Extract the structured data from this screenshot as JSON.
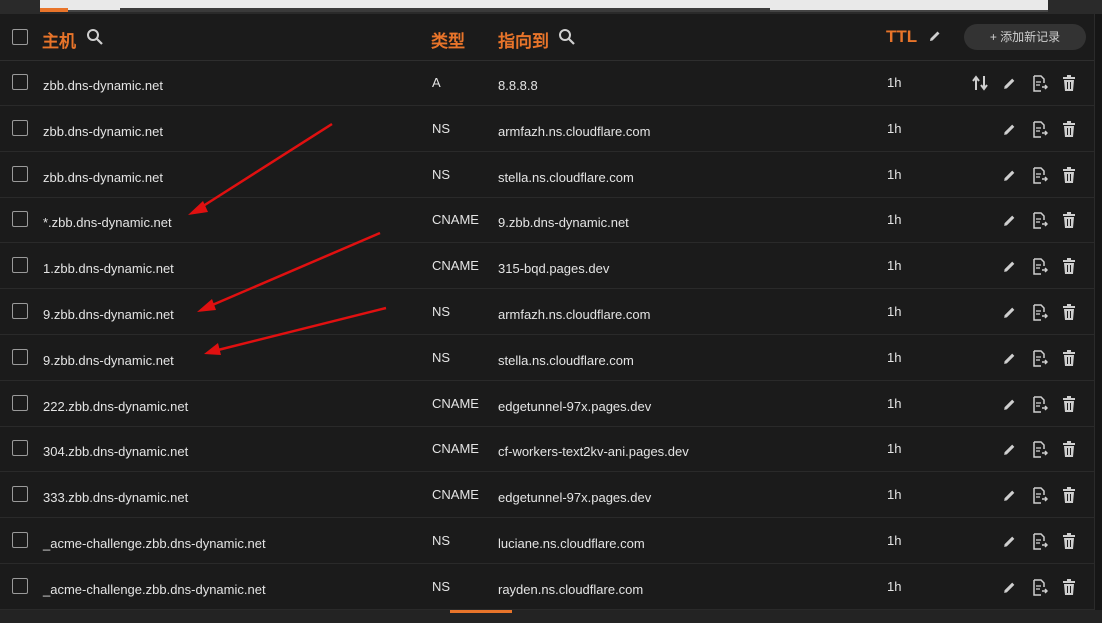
{
  "header": {
    "host_label": "主机",
    "type_label": "类型",
    "target_label": "指向到",
    "ttl_label": "TTL",
    "add_button_label": "+ 添加新记录"
  },
  "records": [
    {
      "host": "zbb.dns-dynamic.net",
      "type": "A",
      "target": "8.8.8.8",
      "ttl": "1h",
      "proxy_toggle": true
    },
    {
      "host": "zbb.dns-dynamic.net",
      "type": "NS",
      "target": "armfazh.ns.cloudflare.com",
      "ttl": "1h",
      "proxy_toggle": false
    },
    {
      "host": "zbb.dns-dynamic.net",
      "type": "NS",
      "target": "stella.ns.cloudflare.com",
      "ttl": "1h",
      "proxy_toggle": false
    },
    {
      "host": "*.zbb.dns-dynamic.net",
      "type": "CNAME",
      "target": "9.zbb.dns-dynamic.net",
      "ttl": "1h",
      "proxy_toggle": false
    },
    {
      "host": "1.zbb.dns-dynamic.net",
      "type": "CNAME",
      "target": "315-bqd.pages.dev",
      "ttl": "1h",
      "proxy_toggle": false
    },
    {
      "host": "9.zbb.dns-dynamic.net",
      "type": "NS",
      "target": "armfazh.ns.cloudflare.com",
      "ttl": "1h",
      "proxy_toggle": false
    },
    {
      "host": "9.zbb.dns-dynamic.net",
      "type": "NS",
      "target": "stella.ns.cloudflare.com",
      "ttl": "1h",
      "proxy_toggle": false
    },
    {
      "host": "222.zbb.dns-dynamic.net",
      "type": "CNAME",
      "target": "edgetunnel-97x.pages.dev",
      "ttl": "1h",
      "proxy_toggle": false
    },
    {
      "host": "304.zbb.dns-dynamic.net",
      "type": "CNAME",
      "target": "cf-workers-text2kv-ani.pages.dev",
      "ttl": "1h",
      "proxy_toggle": false
    },
    {
      "host": "333.zbb.dns-dynamic.net",
      "type": "CNAME",
      "target": "edgetunnel-97x.pages.dev",
      "ttl": "1h",
      "proxy_toggle": false
    },
    {
      "host": "_acme-challenge.zbb.dns-dynamic.net",
      "type": "NS",
      "target": "luciane.ns.cloudflare.com",
      "ttl": "1h",
      "proxy_toggle": false
    },
    {
      "host": "_acme-challenge.zbb.dns-dynamic.net",
      "type": "NS",
      "target": "rayden.ns.cloudflare.com",
      "ttl": "1h",
      "proxy_toggle": false
    }
  ],
  "icons": {
    "search": "search-icon",
    "edit": "pencil-icon",
    "export": "export-document-icon",
    "delete": "trash-icon",
    "sort": "sort-arrows-icon"
  },
  "colors": {
    "accent": "#e8742a",
    "annotation_arrow": "#e01010",
    "text": "#e4e4e4",
    "background": "#1b1b1b"
  }
}
